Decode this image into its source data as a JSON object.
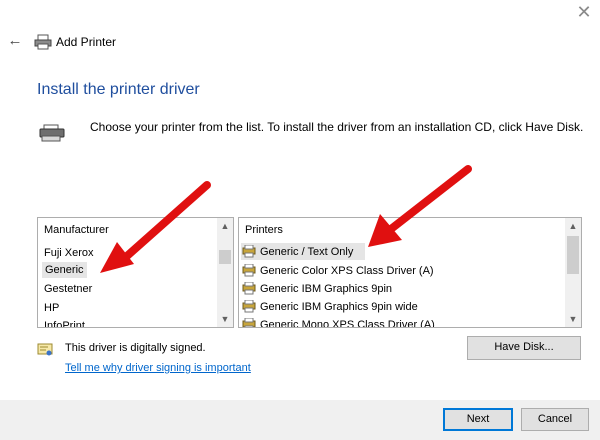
{
  "window": {
    "title": "Add Printer",
    "close_glyph": "✕",
    "back_glyph": "←"
  },
  "page": {
    "heading": "Install the printer driver",
    "instruction": "Choose your printer from the list. To install the driver from an installation CD, click Have Disk."
  },
  "manufacturer_list": {
    "header": "Manufacturer",
    "items": [
      "Fuji Xerox",
      "Generic",
      "Gestetner",
      "HP",
      "InfoPrint"
    ],
    "selected": "Generic"
  },
  "printers_list": {
    "header": "Printers",
    "items": [
      "Generic / Text Only",
      "Generic Color XPS Class Driver (A)",
      "Generic IBM Graphics 9pin",
      "Generic IBM Graphics 9pin wide",
      "Generic Mono XPS Class Driver (A)"
    ],
    "selected": "Generic / Text Only"
  },
  "signing": {
    "status": "This driver is digitally signed.",
    "link": "Tell me why driver signing is important"
  },
  "buttons": {
    "have_disk": "Have Disk...",
    "next": "Next",
    "cancel": "Cancel"
  },
  "colors": {
    "heading": "#1f4e9e",
    "annotation_arrow": "#e01010",
    "link": "#0066cc",
    "default_button_border": "#0078d7"
  }
}
